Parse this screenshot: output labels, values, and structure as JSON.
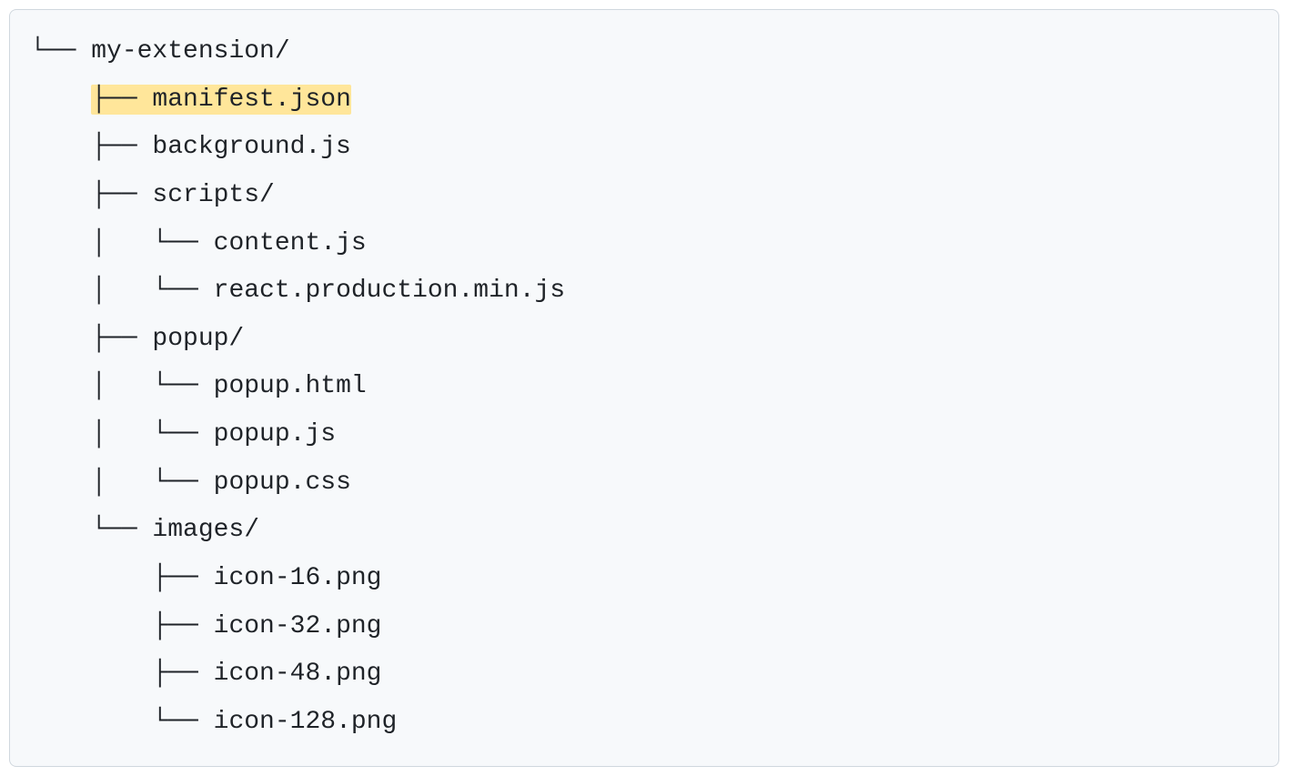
{
  "tree": {
    "lines": [
      {
        "prefix": "└── ",
        "text": "my-extension/",
        "highlighted": false
      },
      {
        "prefix": "    ",
        "text": "├── manifest.json",
        "highlighted": true
      },
      {
        "prefix": "    ├── ",
        "text": "background.js",
        "highlighted": false
      },
      {
        "prefix": "    ├── ",
        "text": "scripts/",
        "highlighted": false
      },
      {
        "prefix": "    │   └── ",
        "text": "content.js",
        "highlighted": false
      },
      {
        "prefix": "    │   └── ",
        "text": "react.production.min.js",
        "highlighted": false
      },
      {
        "prefix": "    ├── ",
        "text": "popup/",
        "highlighted": false
      },
      {
        "prefix": "    │   └── ",
        "text": "popup.html",
        "highlighted": false
      },
      {
        "prefix": "    │   └── ",
        "text": "popup.js",
        "highlighted": false
      },
      {
        "prefix": "    │   └── ",
        "text": "popup.css",
        "highlighted": false
      },
      {
        "prefix": "    └── ",
        "text": "images/",
        "highlighted": false
      },
      {
        "prefix": "        ├── ",
        "text": "icon-16.png",
        "highlighted": false
      },
      {
        "prefix": "        ├── ",
        "text": "icon-32.png",
        "highlighted": false
      },
      {
        "prefix": "        ├── ",
        "text": "icon-48.png",
        "highlighted": false
      },
      {
        "prefix": "        └── ",
        "text": "icon-128.png",
        "highlighted": false
      }
    ]
  }
}
